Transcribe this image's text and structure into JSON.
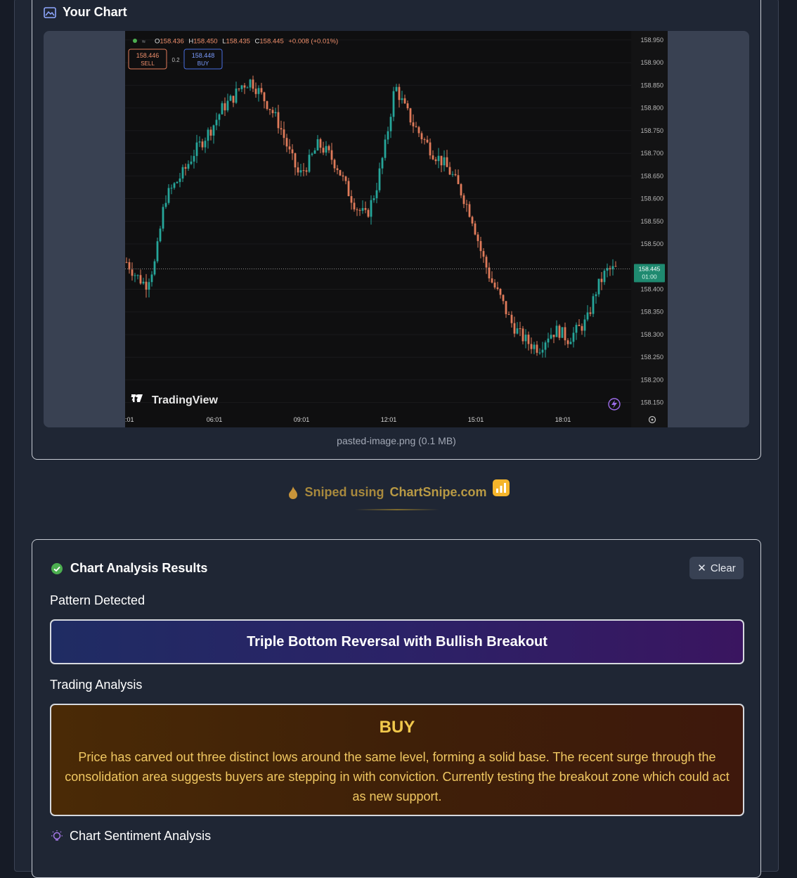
{
  "chart_card": {
    "title": "Your Chart",
    "file_caption": "pasted-image.png (0.1 MB)"
  },
  "tradingview": {
    "ohlc": {
      "o_label": "O",
      "o": "158.436",
      "h_label": "H",
      "h": "158.450",
      "l_label": "L",
      "l": "158.435",
      "c_label": "C",
      "c": "158.445",
      "change": "+0.008 (+0.01%)"
    },
    "sell_price": "158.446",
    "sell_label": "SELL",
    "spread": "0.2",
    "buy_price": "158.448",
    "buy_label": "BUY",
    "logo_text": "TradingView",
    "current_price": "158.445",
    "current_time": "01:00",
    "y_ticks": [
      "158.950",
      "158.900",
      "158.850",
      "158.800",
      "158.750",
      "158.700",
      "158.650",
      "158.600",
      "158.550",
      "158.500",
      "158.400",
      "158.350",
      "158.300",
      "158.250",
      "158.200",
      "158.150"
    ],
    "x_ticks": [
      ":01",
      "06:01",
      "09:01",
      "12:01",
      "15:01",
      "18:01"
    ]
  },
  "chart_data": {
    "type": "candlestick",
    "ylim": [
      158.12,
      158.97
    ],
    "current_price": 158.445,
    "x_tick_labels": [
      ":01",
      "06:01",
      "09:01",
      "12:01",
      "15:01",
      "18:01"
    ],
    "close_path": [
      158.46,
      158.43,
      158.41,
      158.46,
      158.6,
      158.63,
      158.66,
      158.7,
      158.73,
      158.76,
      158.8,
      158.82,
      158.85,
      158.86,
      158.83,
      158.8,
      158.76,
      158.7,
      158.65,
      158.68,
      158.72,
      158.7,
      158.67,
      158.62,
      158.58,
      158.56,
      158.62,
      158.72,
      158.85,
      158.8,
      158.76,
      158.73,
      158.7,
      158.68,
      158.65,
      158.61,
      158.56,
      158.48,
      158.42,
      158.38,
      158.33,
      158.3,
      158.28,
      158.27,
      158.3,
      158.31,
      158.29,
      158.31,
      158.33,
      158.4,
      158.44,
      158.445
    ]
  },
  "brand": {
    "prefix": "Sniped using",
    "site": "ChartSnipe.com"
  },
  "results": {
    "title": "Chart Analysis Results",
    "clear_label": "Clear",
    "pattern_label": "Pattern Detected",
    "pattern": "Triple Bottom Reversal with Bullish Breakout",
    "analysis_label": "Trading Analysis",
    "signal": "BUY",
    "analysis_text": "Price has carved out three distinct lows around the same level, forming a solid base. The recent surge through the consolidation area suggests buyers are stepping in with conviction. Currently testing the breakout zone which could act as new support.",
    "sentiment_label": "Chart Sentiment Analysis"
  },
  "colors": {
    "page_bg": "#161b26",
    "card_bg": "#1f2634",
    "bull": "#26a69a",
    "bear": "#e07b5a",
    "buy_text": "#f2c94c",
    "success": "#4caf50",
    "sentiment_icon": "#a678e8"
  },
  "icons": {
    "chart_card": "image-icon",
    "results": "check-circle-icon",
    "clear": "close-icon",
    "brand_left": "fire-icon",
    "brand_right": "bar-chart-icon",
    "sentiment": "lightbulb-icon",
    "tv_settings": "gear-icon",
    "tv_lightning": "lightning-icon"
  }
}
